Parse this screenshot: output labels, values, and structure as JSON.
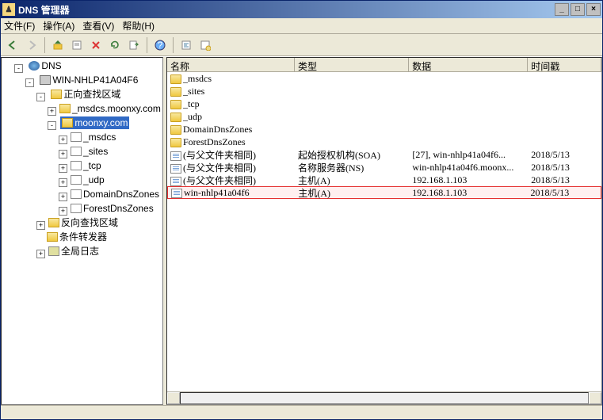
{
  "window": {
    "title": "DNS 管理器"
  },
  "menu": {
    "file": "文件(F)",
    "action": "操作(A)",
    "view": "查看(V)",
    "help": "帮助(H)"
  },
  "winbtn": {
    "min": "_",
    "max": "□",
    "close": "×"
  },
  "tree": {
    "root": "DNS",
    "server": "WIN-NHLP41A04F6",
    "fwd": "正向查找区域",
    "zone1": "_msdcs.moonxy.com",
    "zone2": "moonxy.com",
    "z2_children": [
      "_msdcs",
      "_sites",
      "_tcp",
      "_udp",
      "DomainDnsZones",
      "ForestDnsZones"
    ],
    "rev": "反向查找区域",
    "cond": "条件转发器",
    "glob": "全局日志"
  },
  "columns": {
    "name": "名称",
    "type": "类型",
    "data": "数据",
    "ts": "时间戳"
  },
  "colwidth": {
    "name": 174,
    "type": 156,
    "data": 162,
    "ts": 100
  },
  "rows": [
    {
      "icon": "folder",
      "name": "_msdcs",
      "type": "",
      "data": "",
      "ts": ""
    },
    {
      "icon": "folder",
      "name": "_sites",
      "type": "",
      "data": "",
      "ts": ""
    },
    {
      "icon": "folder",
      "name": "_tcp",
      "type": "",
      "data": "",
      "ts": ""
    },
    {
      "icon": "folder",
      "name": "_udp",
      "type": "",
      "data": "",
      "ts": ""
    },
    {
      "icon": "folder",
      "name": "DomainDnsZones",
      "type": "",
      "data": "",
      "ts": ""
    },
    {
      "icon": "folder",
      "name": "ForestDnsZones",
      "type": "",
      "data": "",
      "ts": ""
    },
    {
      "icon": "rec",
      "name": "(与父文件夹相同)",
      "type": "起始授权机构(SOA)",
      "data": "[27], win-nhlp41a04f6...",
      "ts": "2018/5/13"
    },
    {
      "icon": "rec",
      "name": "(与父文件夹相同)",
      "type": "名称服务器(NS)",
      "data": "win-nhlp41a04f6.moonx...",
      "ts": "2018/5/13"
    },
    {
      "icon": "rec",
      "name": "(与父文件夹相同)",
      "type": "主机(A)",
      "data": "192.168.1.103",
      "ts": "2018/5/13"
    },
    {
      "icon": "rec",
      "name": "win-nhlp41a04f6",
      "type": "主机(A)",
      "data": "192.168.1.103",
      "ts": "2018/5/13",
      "highlight": true
    }
  ]
}
